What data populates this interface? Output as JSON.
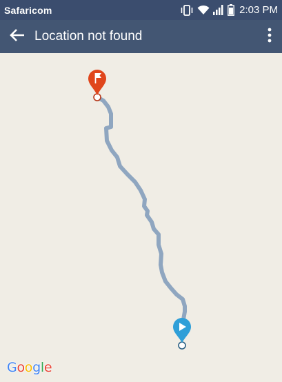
{
  "status_bar": {
    "carrier": "Safaricom",
    "time": "2:03 PM",
    "icons": [
      "vibrate-icon",
      "wifi-icon",
      "signal-icon",
      "battery-icon"
    ]
  },
  "app_bar": {
    "title": "Location not found",
    "back_icon": "arrow-back-icon",
    "menu_icon": "more-vert-icon"
  },
  "map": {
    "route_color": "#8fa6c0",
    "start_marker": {
      "icon": "play-icon",
      "color": "#2f9fd8"
    },
    "end_marker": {
      "icon": "flag-icon",
      "color": "#e0461c"
    },
    "attribution": {
      "letters": [
        {
          "char": "G",
          "color": "#4285f4"
        },
        {
          "char": "o",
          "color": "#ea4335"
        },
        {
          "char": "o",
          "color": "#fbbc05"
        },
        {
          "char": "g",
          "color": "#4285f4"
        },
        {
          "char": "l",
          "color": "#34a853"
        },
        {
          "char": "e",
          "color": "#ea4335"
        }
      ]
    }
  },
  "colors": {
    "status_bar": "#3b4d6e",
    "app_bar": "#435673",
    "map_background": "#f0ede5"
  }
}
